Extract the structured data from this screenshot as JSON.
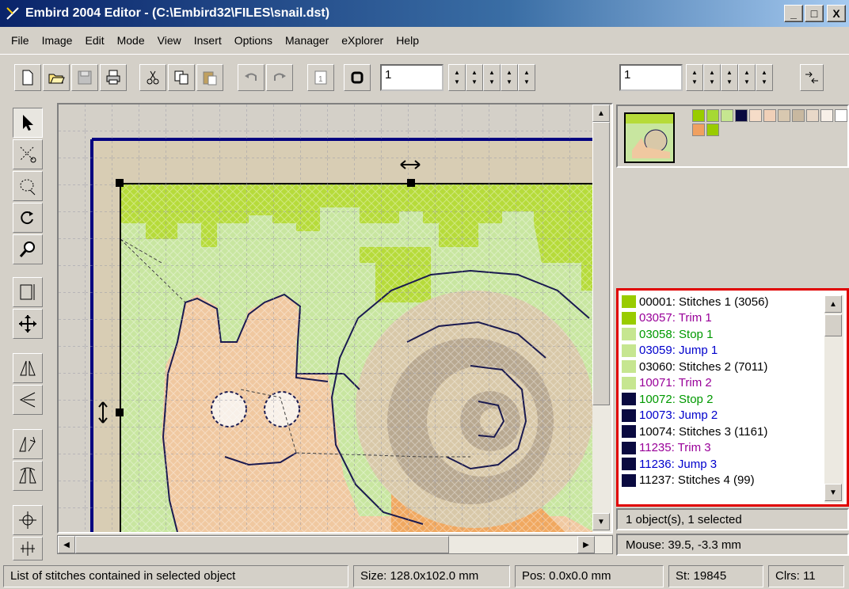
{
  "window": {
    "title": "Embird 2004 Editor - (C:\\Embird32\\FILES\\snail.dst)",
    "min_label": "_",
    "max_label": "□",
    "close_label": "X"
  },
  "menu": [
    {
      "label": "File"
    },
    {
      "label": "Image"
    },
    {
      "label": "Edit"
    },
    {
      "label": "Mode"
    },
    {
      "label": "View"
    },
    {
      "label": "Insert"
    },
    {
      "label": "Options"
    },
    {
      "label": "Manager"
    },
    {
      "label": "eXplorer"
    },
    {
      "label": "Help"
    }
  ],
  "toolbar": {
    "field1_value": "1",
    "field2_value": "1"
  },
  "palette_colors": [
    "#99cc00",
    "#a6d934",
    "#c6e690",
    "#0a0a40",
    "#f5dcc8",
    "#f0d0b8",
    "#d8c8b0",
    "#c8b8a0",
    "#e8d8c8",
    "#f8f0e8",
    "#ffffff",
    "#f0a060",
    "#99cc00"
  ],
  "stitch_list": [
    {
      "text": "00001:  Stitches 1 (3056)",
      "color": "#000000",
      "chip": "#99cc00"
    },
    {
      "text": "03057:  Trim 1",
      "color": "#990099",
      "chip": "#99cc00"
    },
    {
      "text": "03058:  Stop 1",
      "color": "#009900",
      "chip": "#c6e690"
    },
    {
      "text": "03059:  Jump 1",
      "color": "#0000cc",
      "chip": "#c6e690"
    },
    {
      "text": "03060:  Stitches 2 (7011)",
      "color": "#000000",
      "chip": "#c6e690"
    },
    {
      "text": "10071:  Trim 2",
      "color": "#990099",
      "chip": "#c6e690"
    },
    {
      "text": "10072:  Stop 2",
      "color": "#009900",
      "chip": "#0a0a40"
    },
    {
      "text": "10073:  Jump 2",
      "color": "#0000cc",
      "chip": "#0a0a40"
    },
    {
      "text": "10074:  Stitches 3 (1161)",
      "color": "#000000",
      "chip": "#0a0a40"
    },
    {
      "text": "11235:  Trim 3",
      "color": "#990099",
      "chip": "#0a0a40"
    },
    {
      "text": "11236:  Jump 3",
      "color": "#0000cc",
      "chip": "#0a0a40"
    },
    {
      "text": "11237:  Stitches 4 (99)",
      "color": "#000000",
      "chip": "#0a0a40"
    }
  ],
  "info": {
    "selection": "1 object(s), 1 selected",
    "mouse": "Mouse: 39.5, -3.3 mm"
  },
  "status": {
    "hint": "List of stitches contained in selected object",
    "size": "Size: 128.0x102.0 mm",
    "pos": "Pos: 0.0x0.0 mm",
    "stitches": "St: 19845",
    "colors": "Clrs: 11"
  }
}
